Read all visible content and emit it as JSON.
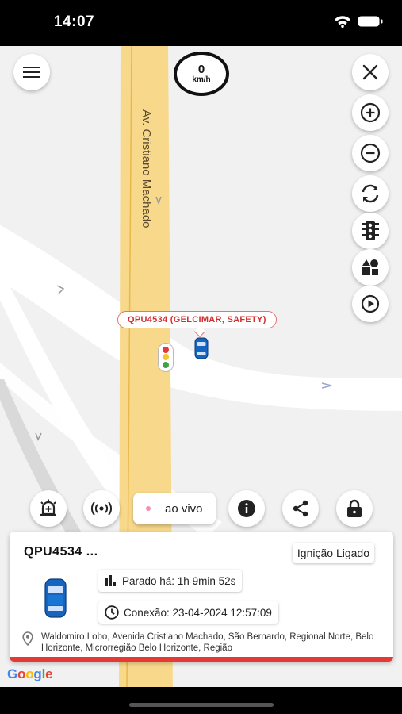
{
  "status_bar": {
    "time": "14:07"
  },
  "speed": {
    "value": "0",
    "unit": "km/h"
  },
  "map": {
    "street_name": "Av. Cristiano Machado",
    "vehicle_tag": "QPU4534 (GELCIMAR, SAFETY)",
    "google_logo": "Google"
  },
  "toolbar": {
    "menu_icon": "hamburger-icon",
    "close_icon": "close-icon",
    "zoom_in_icon": "plus-circle-icon",
    "zoom_out_icon": "minus-circle-icon",
    "refresh_icon": "refresh-icon",
    "traffic_icon": "traffic-light-icon",
    "layers_icon": "map-layers-icon",
    "play_icon": "play-circle-icon"
  },
  "actions": {
    "live_label": "ao vivo",
    "alarm_icon": "alarm-add-icon",
    "signal_icon": "signal-broadcast-icon",
    "info_icon": "info-icon",
    "share_icon": "share-icon",
    "lock_icon": "lock-icon"
  },
  "card": {
    "plate": "QPU4534 ...",
    "ignition": "Ignição Ligado",
    "stopped": "Parado há: 1h 9min 52s",
    "connection": "Conexão: 23-04-2024 12:57:09",
    "address": "Waldomiro Lobo, Avenida Cristiano Machado, São Bernardo, Regional Norte, Belo Horizonte, Microrregião Belo Horizonte, Região"
  },
  "colors": {
    "avenue": "#f8d98c",
    "vehicle_blue": "#1565c0",
    "alert_red": "#e53935"
  }
}
